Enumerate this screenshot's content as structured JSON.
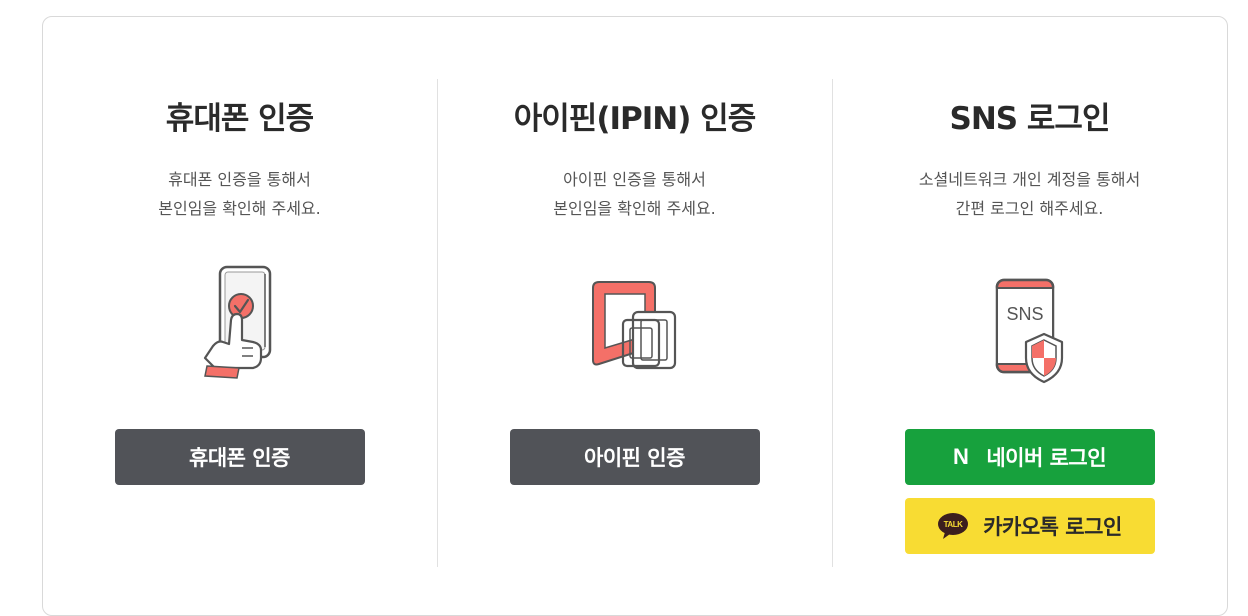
{
  "phone_auth": {
    "title": "휴대폰 인증",
    "desc_line1": "휴대폰 인증을 통해서",
    "desc_line2": "본인임을 확인해 주세요.",
    "button_label": "휴대폰 인증",
    "icon": "phone-touch-check-icon"
  },
  "ipin_auth": {
    "title": "아이핀(IPIN) 인증",
    "desc_line1": "아이핀 인증을 통해서",
    "desc_line2": "본인임을 확인해 주세요.",
    "button_label": "아이핀 인증",
    "icon": "ipin-icon"
  },
  "sns_login": {
    "title": "SNS 로그인",
    "desc_line1": "소셜네트워크 개인 계정을 통해서",
    "desc_line2": "간편 로그인 해주세요.",
    "phone_text": "SNS",
    "naver_logo": "N",
    "naver_label": "네이버 로그인",
    "kakao_logo_text": "TALK",
    "kakao_label": "카카오톡 로그인",
    "icon": "sns-shield-phone-icon"
  },
  "colors": {
    "accent_red": "#f47068",
    "button_gray": "#515358",
    "naver_green": "#17a13d",
    "kakao_yellow": "#f8dc33"
  }
}
